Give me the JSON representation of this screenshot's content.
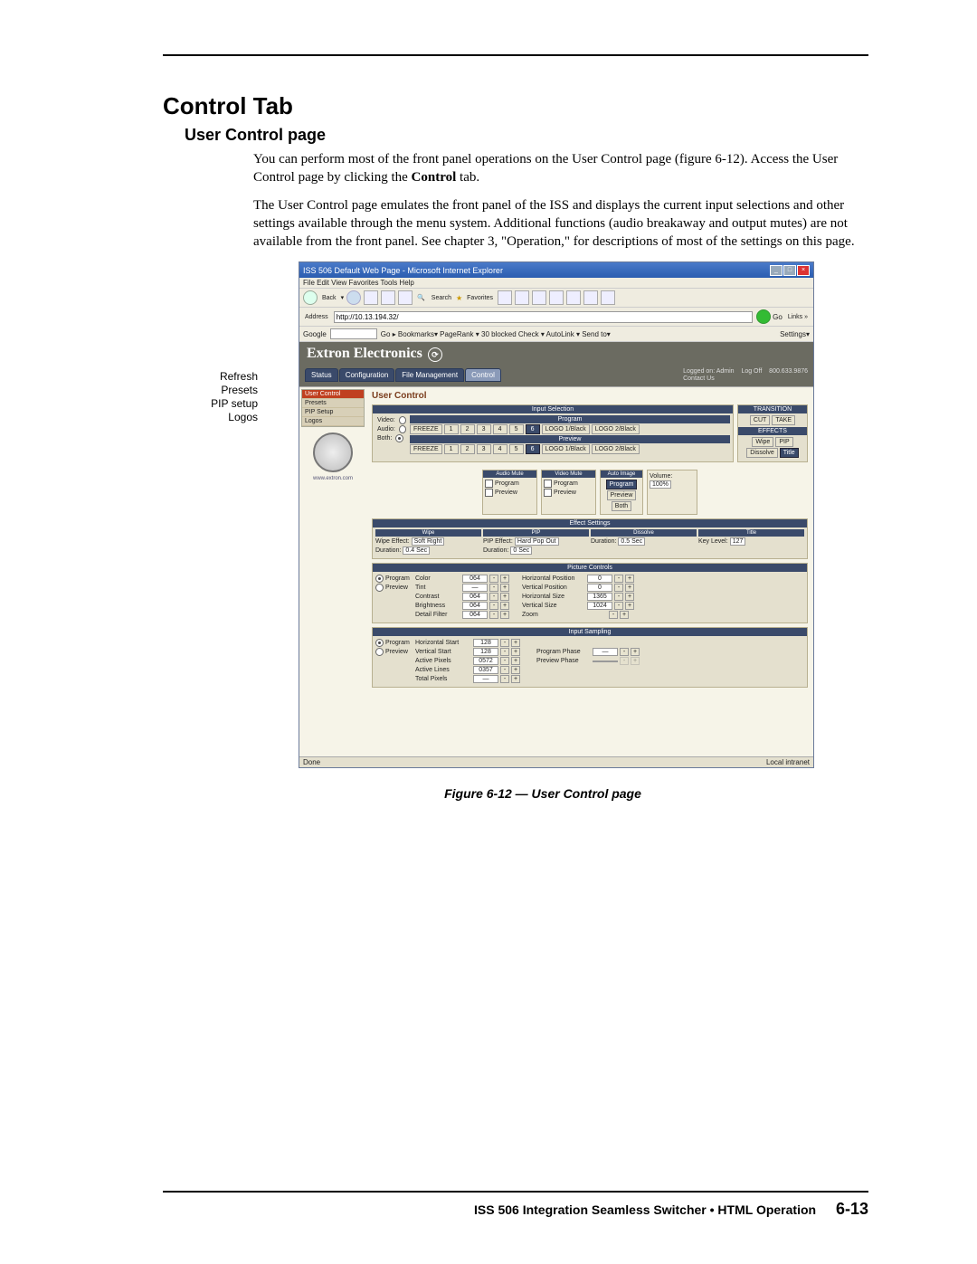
{
  "headings": {
    "h1": "Control Tab",
    "h2": "User Control page"
  },
  "paragraphs": {
    "p1a": "You can perform most of the front panel operations on the User Control page (figure 6-12).  Access the User Control page by clicking the ",
    "p1b": "Control",
    "p1c": " tab.",
    "p2": "The User Control page emulates the front panel of the ISS and displays the current input selections and other settings available through the menu system.  Additional functions (audio breakaway and output mutes) are not available from the front panel.  See chapter 3, \"Operation,\" for descriptions of most of the settings on this page."
  },
  "callouts": {
    "c1": "Refresh",
    "c2": "Presets",
    "c3": "PIP setup",
    "c4": "Logos"
  },
  "browser": {
    "title": "ISS 506 Default Web Page - Microsoft Internet Explorer",
    "menu": "File   Edit   View   Favorites   Tools   Help",
    "back": "Back",
    "search": "Search",
    "favorites": "Favorites",
    "address": "http://10.13.194.32/",
    "go": "Go",
    "google": "Google",
    "gtoolbar": "Go ▸   Bookmarks▾   PageRank ▾   30 blocked   Check ▾   AutoLink ▾   Send to▾",
    "settings": "Settings▾",
    "status_done": "Done",
    "status_intranet": "Local intranet"
  },
  "banner": {
    "brand": "Extron Electronics",
    "logged": "Logged on: Admin",
    "logoff": "Log Off",
    "phone": "800.633.9876",
    "contact": "Contact Us"
  },
  "tabs": {
    "t1": "Status",
    "t2": "Configuration",
    "t3": "File Management",
    "t4": "Control"
  },
  "side": {
    "title": "User Control",
    "m1": "User Control",
    "m2": "Presets",
    "m3": "PIP Setup",
    "m4": "Logos",
    "url": "www.extron.com"
  },
  "inputsel": {
    "head": "Input Selection",
    "video": "Video:",
    "audio": "Audio:",
    "both": "Both:",
    "program": "Program",
    "preview": "Preview",
    "freeze": "FREEZE",
    "logo1": "LOGO 1/Black",
    "logo2": "LOGO 2/Black"
  },
  "transition": {
    "head": "TRANSITION",
    "cut": "CUT",
    "take": "TAKE",
    "effects": "EFFECTS",
    "wipe": "Wipe",
    "pip": "PIP",
    "dissolve": "Dissolve",
    "title": "Title"
  },
  "mutes": {
    "audio_h": "Audio Mute",
    "video_h": "Video Mute",
    "program": "Program",
    "preview": "Preview"
  },
  "auto": {
    "head": "Auto Image",
    "prog": "Program",
    "prev": "Preview",
    "both": "Both"
  },
  "volume": {
    "label": "Volume:",
    "value": "100%"
  },
  "effect": {
    "head": "Effect Settings",
    "wipe": "Wipe",
    "pip": "PIP",
    "dissolve": "Dissolve",
    "title": "Title",
    "wipe_effect": "Wipe Effect:",
    "wipe_val": "Soft Right",
    "wipe_dur_l": "Duration:",
    "wipe_dur_v": "0.4 Sec",
    "pip_effect": "PIP Effect:",
    "pip_val": "Hard Pop Out",
    "pip_dur_l": "Duration:",
    "pip_dur_v": "0 Sec",
    "dis_dur_l": "Duration:",
    "dis_dur_v": "0.5 Sec",
    "key_l": "Key Level:",
    "key_v": "127"
  },
  "picture": {
    "head": "Picture Controls",
    "program": "Program",
    "preview": "Preview",
    "color": "Color",
    "color_v": "064",
    "tint": "Tint",
    "tint_v": "—",
    "contrast": "Contrast",
    "contrast_v": "064",
    "brightness": "Brightness",
    "brightness_v": "064",
    "detail": "Detail Filter",
    "detail_v": "064",
    "hpos": "Horizontal Position",
    "hpos_v": "0",
    "vpos": "Vertical Position",
    "vpos_v": "0",
    "hsize": "Horizontal Size",
    "hsize_v": "1365",
    "vsize": "Vertical Size",
    "vsize_v": "1024",
    "zoom": "Zoom"
  },
  "sampling": {
    "head": "Input Sampling",
    "hs": "Horizontal Start",
    "hs_v": "128",
    "vs": "Vertical Start",
    "vs_v": "128",
    "ap": "Active Pixels",
    "ap_v": "0572",
    "al": "Active Lines",
    "al_v": "0357",
    "tp": "Total Pixels",
    "tp_v": "—",
    "pphase": "Program Phase",
    "pphase_v": "—",
    "vphase": "Preview Phase"
  },
  "caption": "Figure 6-12 — User Control page",
  "footer": {
    "text": "ISS 506 Integration Seamless Switcher • HTML Operation",
    "page": "6-13"
  }
}
